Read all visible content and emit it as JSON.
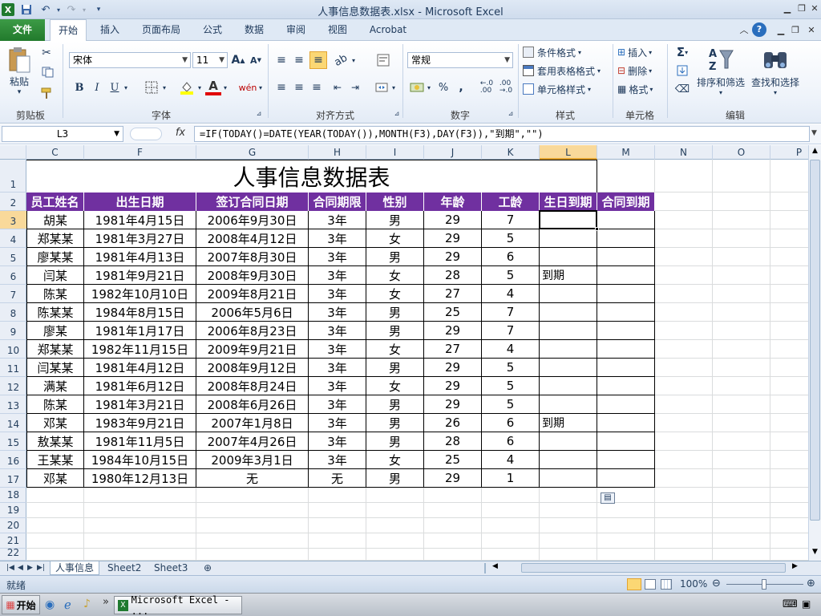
{
  "window": {
    "title": "人事信息数据表.xlsx  -  Microsoft Excel"
  },
  "ribbon": {
    "tabs": [
      "文件",
      "开始",
      "插入",
      "页面布局",
      "公式",
      "数据",
      "审阅",
      "视图",
      "Acrobat"
    ],
    "clipboard": {
      "paste": "粘贴",
      "label": "剪贴板"
    },
    "font": {
      "name": "宋体",
      "size": "11",
      "label": "字体"
    },
    "alignment": {
      "label": "对齐方式"
    },
    "number": {
      "format": "常规",
      "label": "数字"
    },
    "styles": {
      "conditional": "条件格式",
      "table": "套用表格格式",
      "cell": "单元格样式",
      "label": "样式"
    },
    "cells": {
      "insert": "插入",
      "delete": "删除",
      "format": "格式",
      "label": "单元格"
    },
    "editing": {
      "sort": "排序和筛选",
      "find": "查找和选择",
      "label": "编辑"
    }
  },
  "formula_bar": {
    "name_box": "L3",
    "fx": "fx",
    "formula": "=IF(TODAY()=DATE(YEAR(TODAY()),MONTH(F3),DAY(F3)),\"到期\",\"\")"
  },
  "columns": [
    "C",
    "F",
    "G",
    "H",
    "I",
    "J",
    "K",
    "L",
    "M",
    "N",
    "O",
    "P"
  ],
  "rows": [
    "1",
    "2",
    "3",
    "4",
    "5",
    "6",
    "7",
    "8",
    "9",
    "10",
    "11",
    "12",
    "13",
    "14",
    "15",
    "16",
    "17",
    "18",
    "19",
    "20",
    "21",
    "22"
  ],
  "table": {
    "title": "人事信息数据表",
    "headers": [
      "员工姓名",
      "出生日期",
      "签订合同日期",
      "合同期限",
      "性别",
      "年龄",
      "工龄",
      "生日到期",
      "合同到期"
    ],
    "rows": [
      [
        "胡某",
        "1981年4月15日",
        "2006年9月30日",
        "3年",
        "男",
        "29",
        "7",
        "",
        ""
      ],
      [
        "郑某某",
        "1981年3月27日",
        "2008年4月12日",
        "3年",
        "女",
        "29",
        "5",
        "",
        ""
      ],
      [
        "廖某某",
        "1981年4月13日",
        "2007年8月30日",
        "3年",
        "男",
        "29",
        "6",
        "",
        ""
      ],
      [
        "闫某",
        "1981年9月21日",
        "2008年9月30日",
        "3年",
        "女",
        "28",
        "5",
        "到期",
        ""
      ],
      [
        "陈某",
        "1982年10月10日",
        "2009年8月21日",
        "3年",
        "女",
        "27",
        "4",
        "",
        ""
      ],
      [
        "陈某某",
        "1984年8月15日",
        "2006年5月6日",
        "3年",
        "男",
        "25",
        "7",
        "",
        ""
      ],
      [
        "廖某",
        "1981年1月17日",
        "2006年8月23日",
        "3年",
        "男",
        "29",
        "7",
        "",
        ""
      ],
      [
        "郑某某",
        "1982年11月15日",
        "2009年9月21日",
        "3年",
        "女",
        "27",
        "4",
        "",
        ""
      ],
      [
        "闫某某",
        "1981年4月12日",
        "2008年9月12日",
        "3年",
        "男",
        "29",
        "5",
        "",
        ""
      ],
      [
        "满某",
        "1981年6月12日",
        "2008年8月24日",
        "3年",
        "女",
        "29",
        "5",
        "",
        ""
      ],
      [
        "陈某",
        "1981年3月21日",
        "2008年6月26日",
        "3年",
        "男",
        "29",
        "5",
        "",
        ""
      ],
      [
        "邓某",
        "1983年9月21日",
        "2007年1月8日",
        "3年",
        "男",
        "26",
        "6",
        "到期",
        ""
      ],
      [
        "敖某某",
        "1981年11月5日",
        "2007年4月26日",
        "3年",
        "男",
        "28",
        "6",
        "",
        ""
      ],
      [
        "王某某",
        "1984年10月15日",
        "2009年3月1日",
        "3年",
        "女",
        "25",
        "4",
        "",
        ""
      ],
      [
        "邓某",
        "1980年12月13日",
        "无",
        "无",
        "男",
        "29",
        "1",
        "",
        ""
      ]
    ]
  },
  "sheets": [
    "人事信息",
    "Sheet2",
    "Sheet3"
  ],
  "status": {
    "ready": "就绪",
    "zoom": "100%"
  },
  "taskbar": {
    "start": "开始",
    "app": "Microsoft Excel - ..."
  },
  "colors": {
    "header_fill": "#7030a0",
    "file_tab": "#217a2c"
  }
}
